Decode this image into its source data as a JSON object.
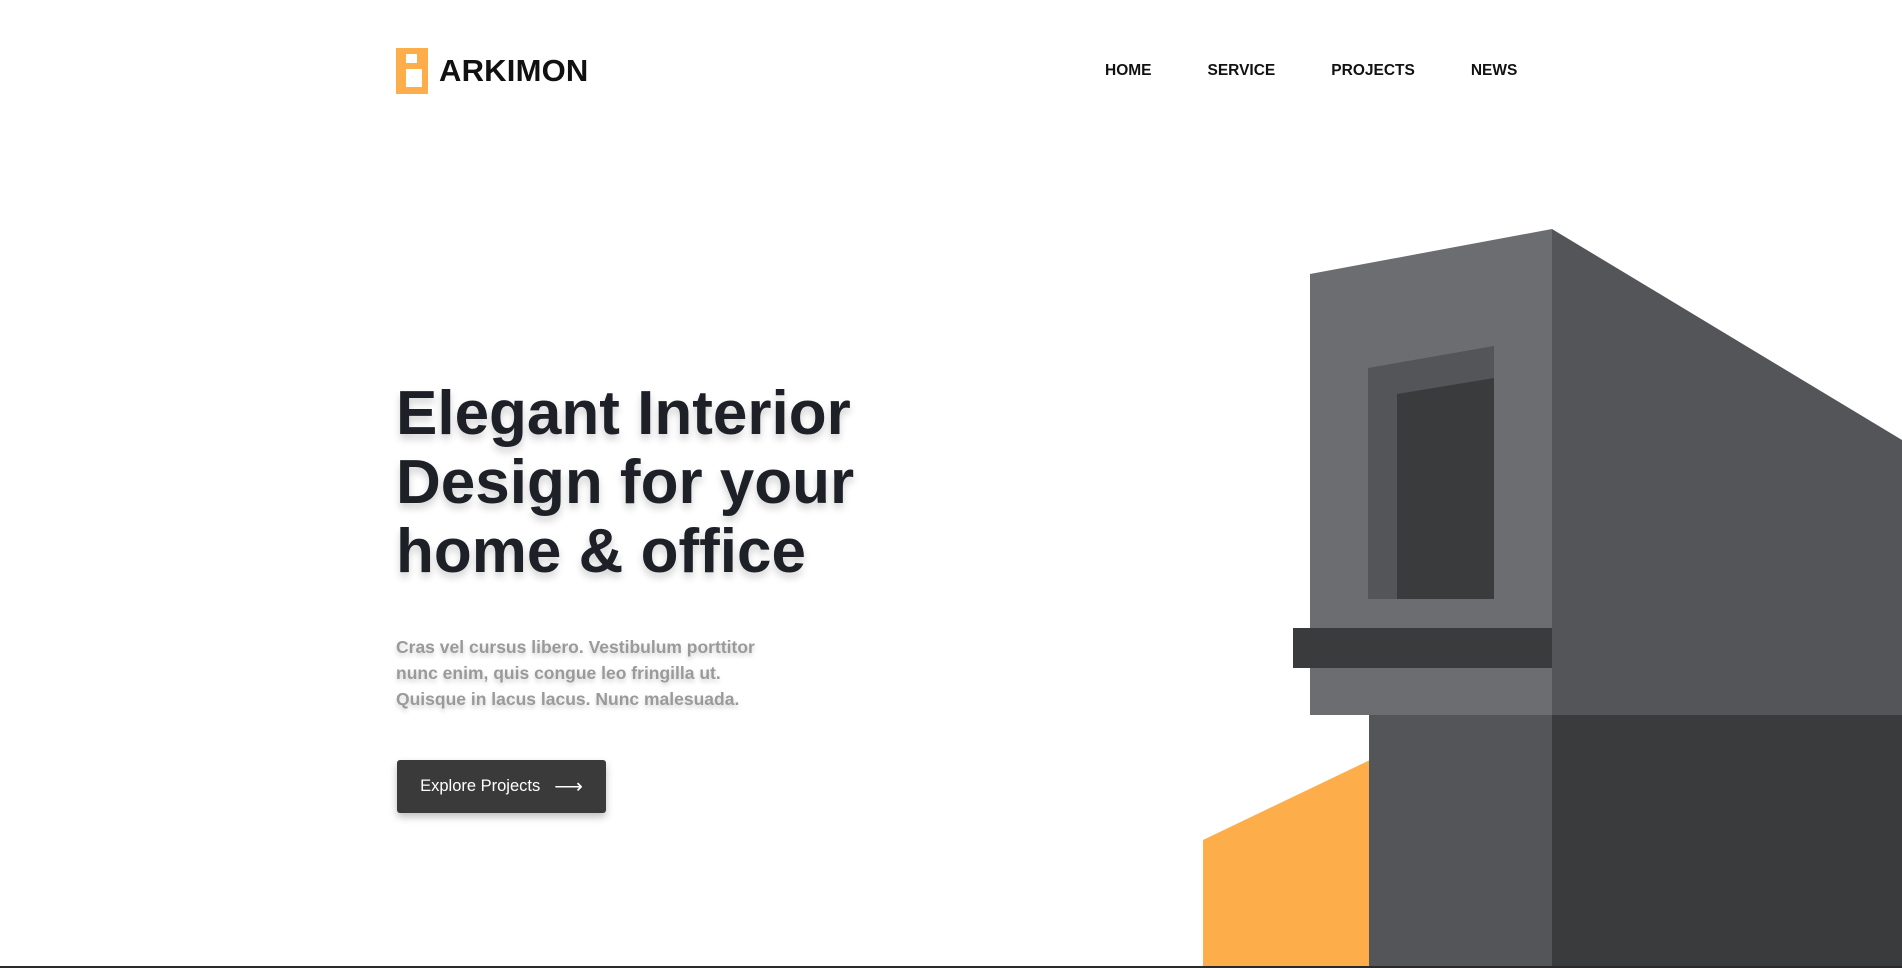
{
  "brand": {
    "name": "ARKIMON",
    "logo_icon": "building-block-logo-icon",
    "accent_color": "#FDAE4B"
  },
  "nav": {
    "items": [
      {
        "label": "HOME"
      },
      {
        "label": "SERVICE"
      },
      {
        "label": "PROJECTS"
      },
      {
        "label": "NEWS"
      }
    ]
  },
  "hero": {
    "title_lines": [
      "Elegant Interior",
      "Design for your",
      "home & office"
    ],
    "description_lines": [
      "Cras vel cursus libero. Vestibulum porttitor",
      "nunc enim, quis congue leo fringilla ut.",
      "Quisque in lacus lacus. Nunc malesuada."
    ],
    "cta_label": "Explore Projects",
    "cta_arrow": "⟶"
  },
  "colors": {
    "text_dark": "#1D2026",
    "text_muted": "#9A9A9A",
    "button_bg": "#3A3A3A",
    "building_light": "#6C6D71",
    "building_mid": "#545558",
    "building_dark": "#393B3C",
    "accent": "#FDAE4B"
  }
}
